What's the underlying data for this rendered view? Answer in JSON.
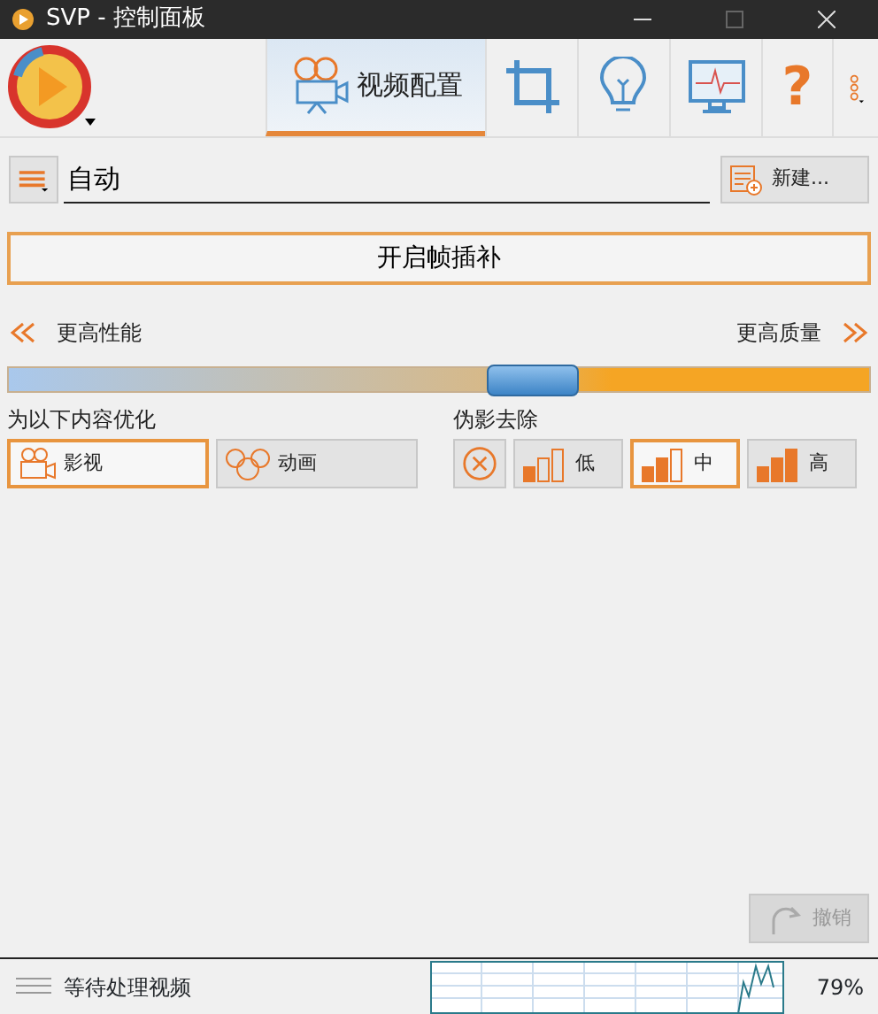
{
  "window": {
    "title": "SVP - 控制面板"
  },
  "toolbar": {
    "tabs": [
      {
        "kind": "video",
        "label": "视频配置",
        "selected": true
      },
      {
        "kind": "crop",
        "selected": false
      },
      {
        "kind": "bulb",
        "selected": false
      },
      {
        "kind": "monitor",
        "selected": false
      },
      {
        "kind": "help",
        "label": "?",
        "selected": false
      },
      {
        "kind": "more",
        "selected": false
      }
    ]
  },
  "profile": {
    "value": "自动",
    "new_button": "新建..."
  },
  "main_button": "开启帧插补",
  "quality": {
    "left_label": "更高性能",
    "right_label": "更高质量",
    "level": 0.61
  },
  "optimize": {
    "title": "为以下内容优化",
    "options": [
      {
        "kind": "film",
        "label": "影视",
        "selected": true
      },
      {
        "kind": "cartoon",
        "label": "动画",
        "selected": false
      }
    ]
  },
  "artifacts": {
    "title": "伪影去除",
    "options": [
      {
        "kind": "off",
        "selected": false
      },
      {
        "kind": "low",
        "label": "低",
        "selected": false
      },
      {
        "kind": "mid",
        "label": "中",
        "selected": true
      },
      {
        "kind": "high",
        "label": "高",
        "selected": false
      }
    ]
  },
  "undo": {
    "label": "撤销",
    "disabled": true
  },
  "status_bar": {
    "text": "等待处理视频",
    "cpu": "79%"
  }
}
